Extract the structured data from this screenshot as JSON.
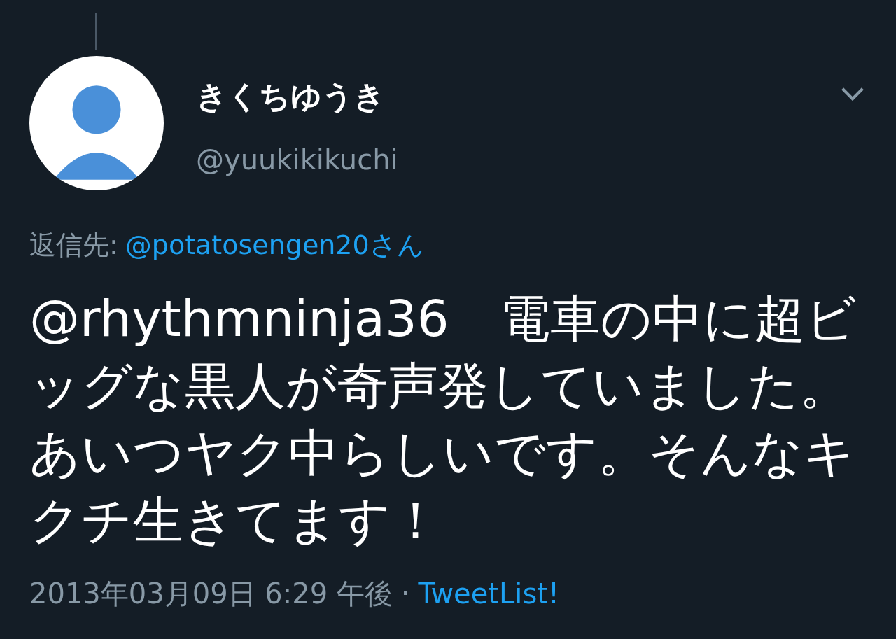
{
  "tweet": {
    "author": {
      "name": "きくちゆうき",
      "handle": "@yuukikikuchi"
    },
    "reply_to": {
      "label": "返信先:",
      "mention": "@potatosengen20さん"
    },
    "text": "@rhythmninja36　電車の中に超ビッグな黒人が奇声発していました。あいつヤク中らしいです。そんなキクチ生きてます！",
    "timestamp": "2013年03月09日 6:29 午後",
    "separator": "·",
    "source": "TweetList!"
  }
}
